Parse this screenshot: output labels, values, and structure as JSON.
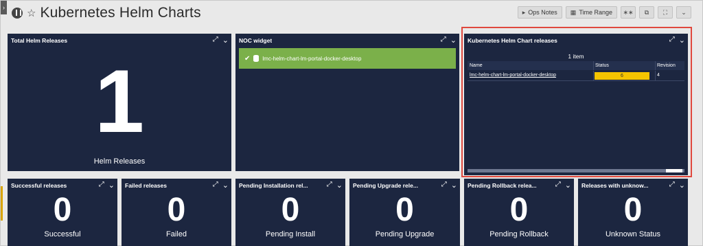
{
  "page": {
    "title": "Kubernetes Helm Charts"
  },
  "icons": {
    "dashboard": "dashboard-icon",
    "favorite": "star-icon",
    "expand": "expand-icon",
    "menu": "chevron-down-icon",
    "check": "check-icon"
  },
  "toolbar": {
    "ops_notes": "Ops Notes",
    "time_range": "Time Range"
  },
  "widgets": {
    "total": {
      "title": "Total Helm Releases",
      "value": "1",
      "label": "Helm Releases"
    },
    "noc": {
      "title": "NOC widget",
      "item": "lmc-helm-chart-lm-portal-docker-desktop",
      "item_color": "#7bb04a"
    },
    "releases": {
      "title": "Kubernetes Helm Chart releases",
      "count": "1 item",
      "columns": [
        "Name",
        "Status",
        "Revision"
      ],
      "rows": [
        {
          "name": "lmc-helm-chart-lm-portal-docker-desktop",
          "status": "6",
          "revision": "4"
        }
      ],
      "status_color": "#f5c400"
    },
    "successful": {
      "title": "Successful releases",
      "value": "0",
      "label": "Successful"
    },
    "failed": {
      "title": "Failed releases",
      "value": "0",
      "label": "Failed"
    },
    "pending_install": {
      "title": "Pending Installation rel...",
      "value": "0",
      "label": "Pending Install"
    },
    "pending_upgrade": {
      "title": "Pending Upgrade rele...",
      "value": "0",
      "label": "Pending Upgrade"
    },
    "pending_rollback": {
      "title": "Pending Rollback relea...",
      "value": "0",
      "label": "Pending Rollback"
    },
    "unknown": {
      "title": "Releases with unknow...",
      "value": "0",
      "label": "Unknown Status"
    }
  },
  "colors": {
    "widget_bg": "#1c2640",
    "highlight": "#e0483d"
  }
}
